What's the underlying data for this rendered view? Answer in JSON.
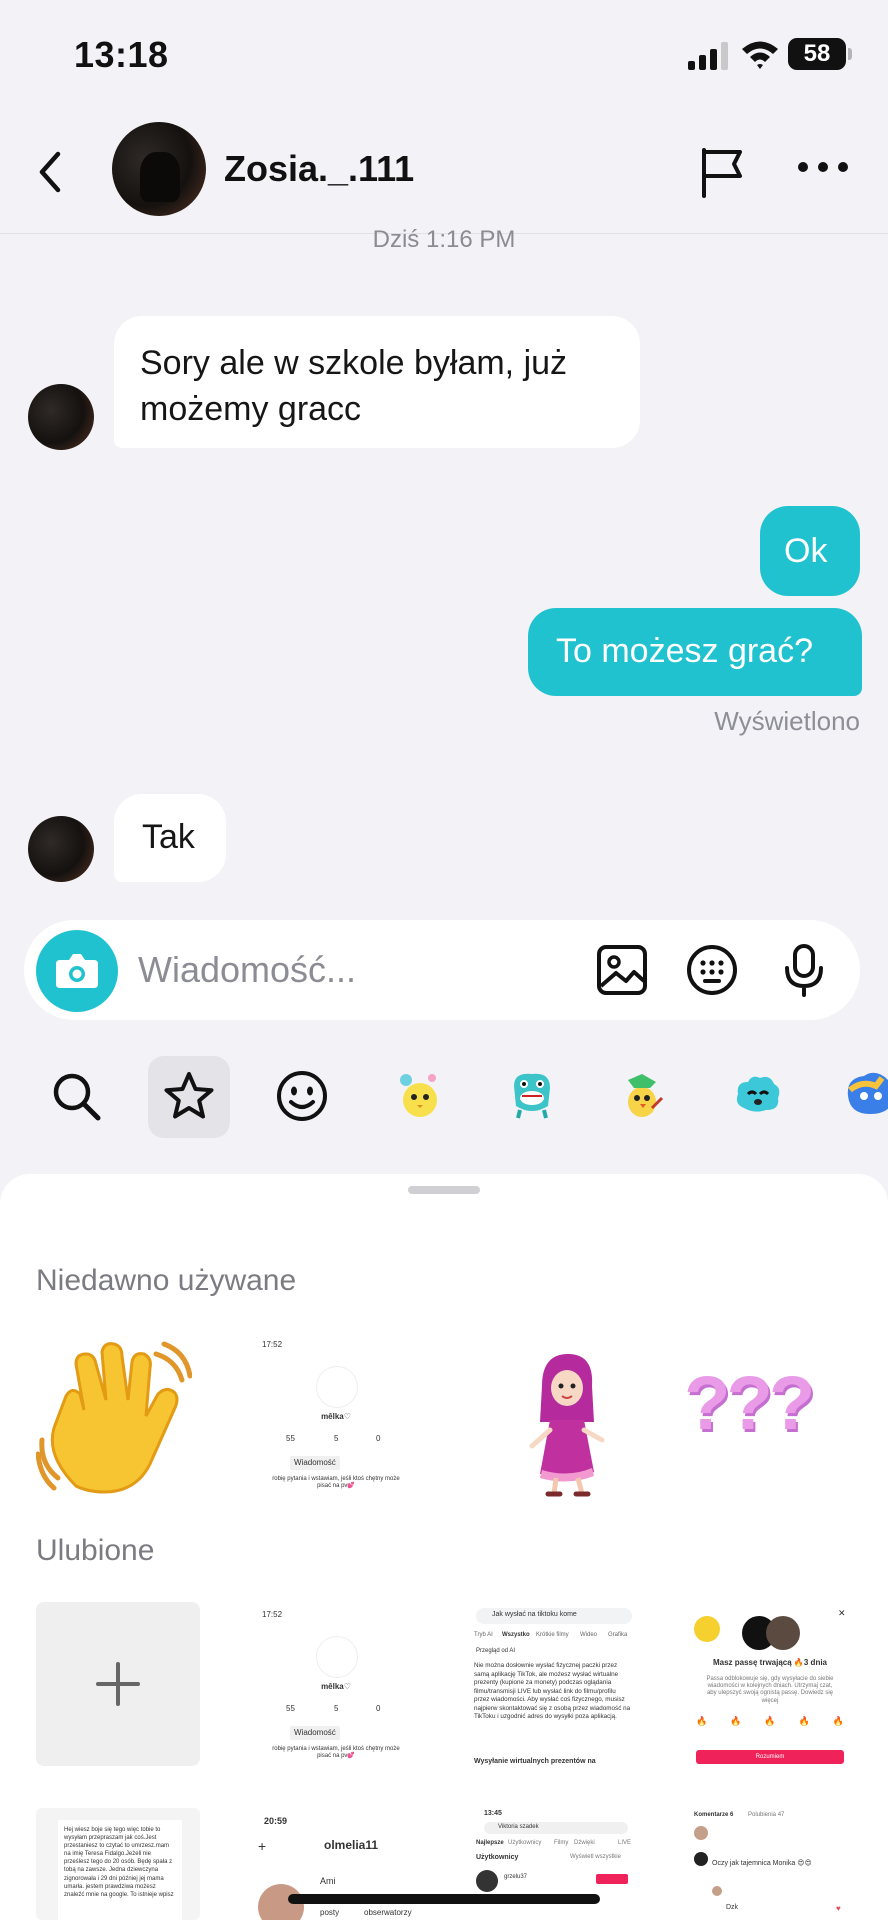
{
  "status": {
    "time": "13:18",
    "battery": "58"
  },
  "header": {
    "contact_name": "Zosia._.111"
  },
  "chat": {
    "timestamp": "Dziś 1:16 PM",
    "messages": [
      {
        "from": "them",
        "text": "Sory ale w szkole byłam, już możemy gracc"
      },
      {
        "from": "me",
        "text": "Ok"
      },
      {
        "from": "me",
        "text": "To możesz grać?"
      },
      {
        "from": "them",
        "text": "Tak"
      }
    ],
    "seen_label": "Wyświetlono"
  },
  "composer": {
    "placeholder": "Wiadomość..."
  },
  "sticker_tabs": [
    "search",
    "favorites",
    "emoji",
    "sticker-1",
    "sticker-2",
    "sticker-3",
    "sticker-4",
    "sticker-5"
  ],
  "panel": {
    "recent_title": "Niedawno używane",
    "favorites_title": "Ulubione",
    "recent": {
      "profile_time": "17:52",
      "profile_name": "mêlka♡",
      "profile_stats": [
        "55",
        "5",
        "0"
      ],
      "profile_button": "Wiadomość",
      "profile_bio": "robię pytania i wstawiam, jeśli ktoś chętny może pisać na pv💕",
      "question_marks": "???"
    },
    "favorites": {
      "profile_time": "17:52",
      "profile_name": "mêlka♡",
      "profile_stats": [
        "55",
        "5",
        "0"
      ],
      "search_query": "Jak wysłać na tiktoku kome",
      "search_tabs": [
        "Tryb AI",
        "Wszystko",
        "Krótkie filmy",
        "Wideo",
        "Grafika"
      ],
      "ai_heading": "Przegląd od AI",
      "ai_text": "Nie można dosłownie wysłać fizycznej paczki przez samą aplikację TikTok, ale możesz wysłać wirtualne prezenty (kupione za monety) podczas oglądania filmu/transmisji LIVE lub wysłać link do filmu/profilu przez wiadomości. Aby wysłać coś fizycznego, musisz najpierw skontaktować się z osobą przez wiadomość na TikToku i uzgodnić adres do wysyłki poza aplikacją.",
      "ai_subheading": "Wysyłanie wirtualnych prezentów na",
      "streak_title": "Masz passę trwającą 🔥3 dnia",
      "streak_text": "Passa odblokowuje się, gdy wysyłacie do siebie wiadomości w kolejnych dniach. Utrzymaj czat, aby ulepszyć swoją ognistą passę. Dowiedz się więcej",
      "streak_button": "Rozumiem"
    },
    "row3": {
      "note_text": "Hej wiesz boje się tego więc tobie to wysyłam przepraszam jak coś.Jest przestaniesz to czytać to umrzesz.mam na imię Teresa Fidalgo.Jeżeli nie prześlesz tego do 20 osób. Będę spała z tobą na zawsze. Jedna dziewczyna zignorowała i 29 dni później jej mama umarła. jestem prawdziwa możesz znaleźć mnie na google. To istnieje wpisz",
      "profile_time": "20:59",
      "profile_user": "olmelia11",
      "profile_name": "Ami",
      "profile_labels": [
        "posty",
        "obserwatorzy"
      ],
      "search_time": "13:45",
      "search_query": "Viktoria szadek",
      "search_tabs": [
        "Najlepsze",
        "Użytkownicy",
        "Filmy",
        "Dźwięki",
        "LIVE"
      ],
      "users_label": "Użytkownicy",
      "see_all": "Wyświetl wszystkie",
      "user_result": "grzelu37",
      "comments_label": "Komentarze 6",
      "likes_label": "Polubienia 47",
      "comment_text": "Oczy jak tajemnica Monika 😍😍",
      "comment_reply": "Dzk"
    }
  },
  "colors": {
    "accent": "#21c2d0",
    "bubble_in": "#ffffff",
    "background": "#f3f2f6"
  }
}
